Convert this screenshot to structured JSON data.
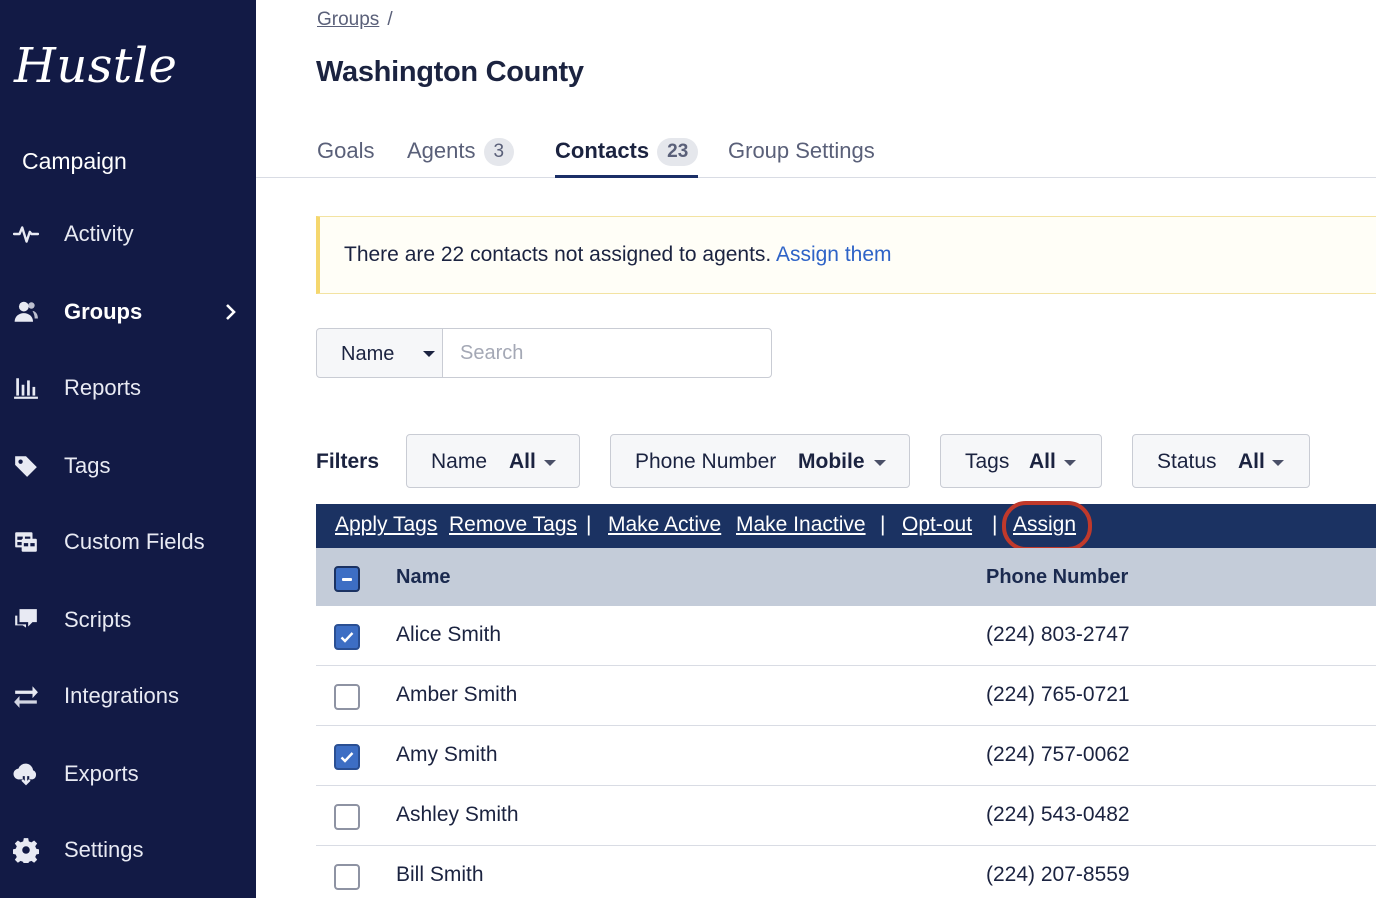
{
  "app": {
    "logo": "Hustle"
  },
  "sidebar": {
    "section": "Campaign",
    "items": [
      {
        "label": "Activity",
        "icon": "activity-icon"
      },
      {
        "label": "Groups",
        "icon": "groups-icon",
        "active": true
      },
      {
        "label": "Reports",
        "icon": "reports-icon"
      },
      {
        "label": "Tags",
        "icon": "tag-icon"
      },
      {
        "label": "Custom Fields",
        "icon": "custom-fields-icon"
      },
      {
        "label": "Scripts",
        "icon": "scripts-icon"
      },
      {
        "label": "Integrations",
        "icon": "integrations-icon"
      },
      {
        "label": "Exports",
        "icon": "exports-icon"
      },
      {
        "label": "Settings",
        "icon": "gear-icon"
      }
    ]
  },
  "header": {
    "breadcrumb": {
      "link": "Groups",
      "separator": "/"
    },
    "title": "Washington County"
  },
  "tabs": [
    {
      "label": "Goals"
    },
    {
      "label": "Agents",
      "count": "3"
    },
    {
      "label": "Contacts",
      "count": "23",
      "active": true
    },
    {
      "label": "Group Settings"
    }
  ],
  "alert": {
    "text": "There are 22 contacts not assigned to agents. ",
    "link": "Assign them"
  },
  "search": {
    "field": "Name",
    "placeholder": "Search",
    "value": ""
  },
  "filters": {
    "label": "Filters",
    "items": [
      {
        "name": "Name",
        "value": "All"
      },
      {
        "name": "Phone Number",
        "value": "Mobile"
      },
      {
        "name": "Tags",
        "value": "All"
      },
      {
        "name": "Status",
        "value": "All"
      }
    ]
  },
  "actions": {
    "apply_tags": "Apply Tags",
    "remove_tags": "Remove Tags",
    "make_active": "Make Active",
    "make_inactive": "Make Inactive",
    "opt_out": "Opt-out",
    "assign": "Assign",
    "separator": "|"
  },
  "table": {
    "columns": {
      "name": "Name",
      "phone": "Phone Number"
    },
    "rows": [
      {
        "name": "Alice Smith",
        "phone": "(224) 803-2747",
        "checked": true
      },
      {
        "name": "Amber Smith",
        "phone": "(224) 765-0721",
        "checked": false
      },
      {
        "name": "Amy Smith",
        "phone": "(224) 757-0062",
        "checked": true
      },
      {
        "name": "Ashley Smith",
        "phone": "(224) 543-0482",
        "checked": false
      },
      {
        "name": "Bill Smith",
        "phone": "(224) 207-8559",
        "checked": false
      }
    ]
  },
  "colors": {
    "sidebar_bg": "#121a45",
    "action_bar_bg": "#1b3262",
    "link": "#2e63c7",
    "highlight": "#c0392b",
    "checkbox_checked": "#3d6ec4"
  }
}
